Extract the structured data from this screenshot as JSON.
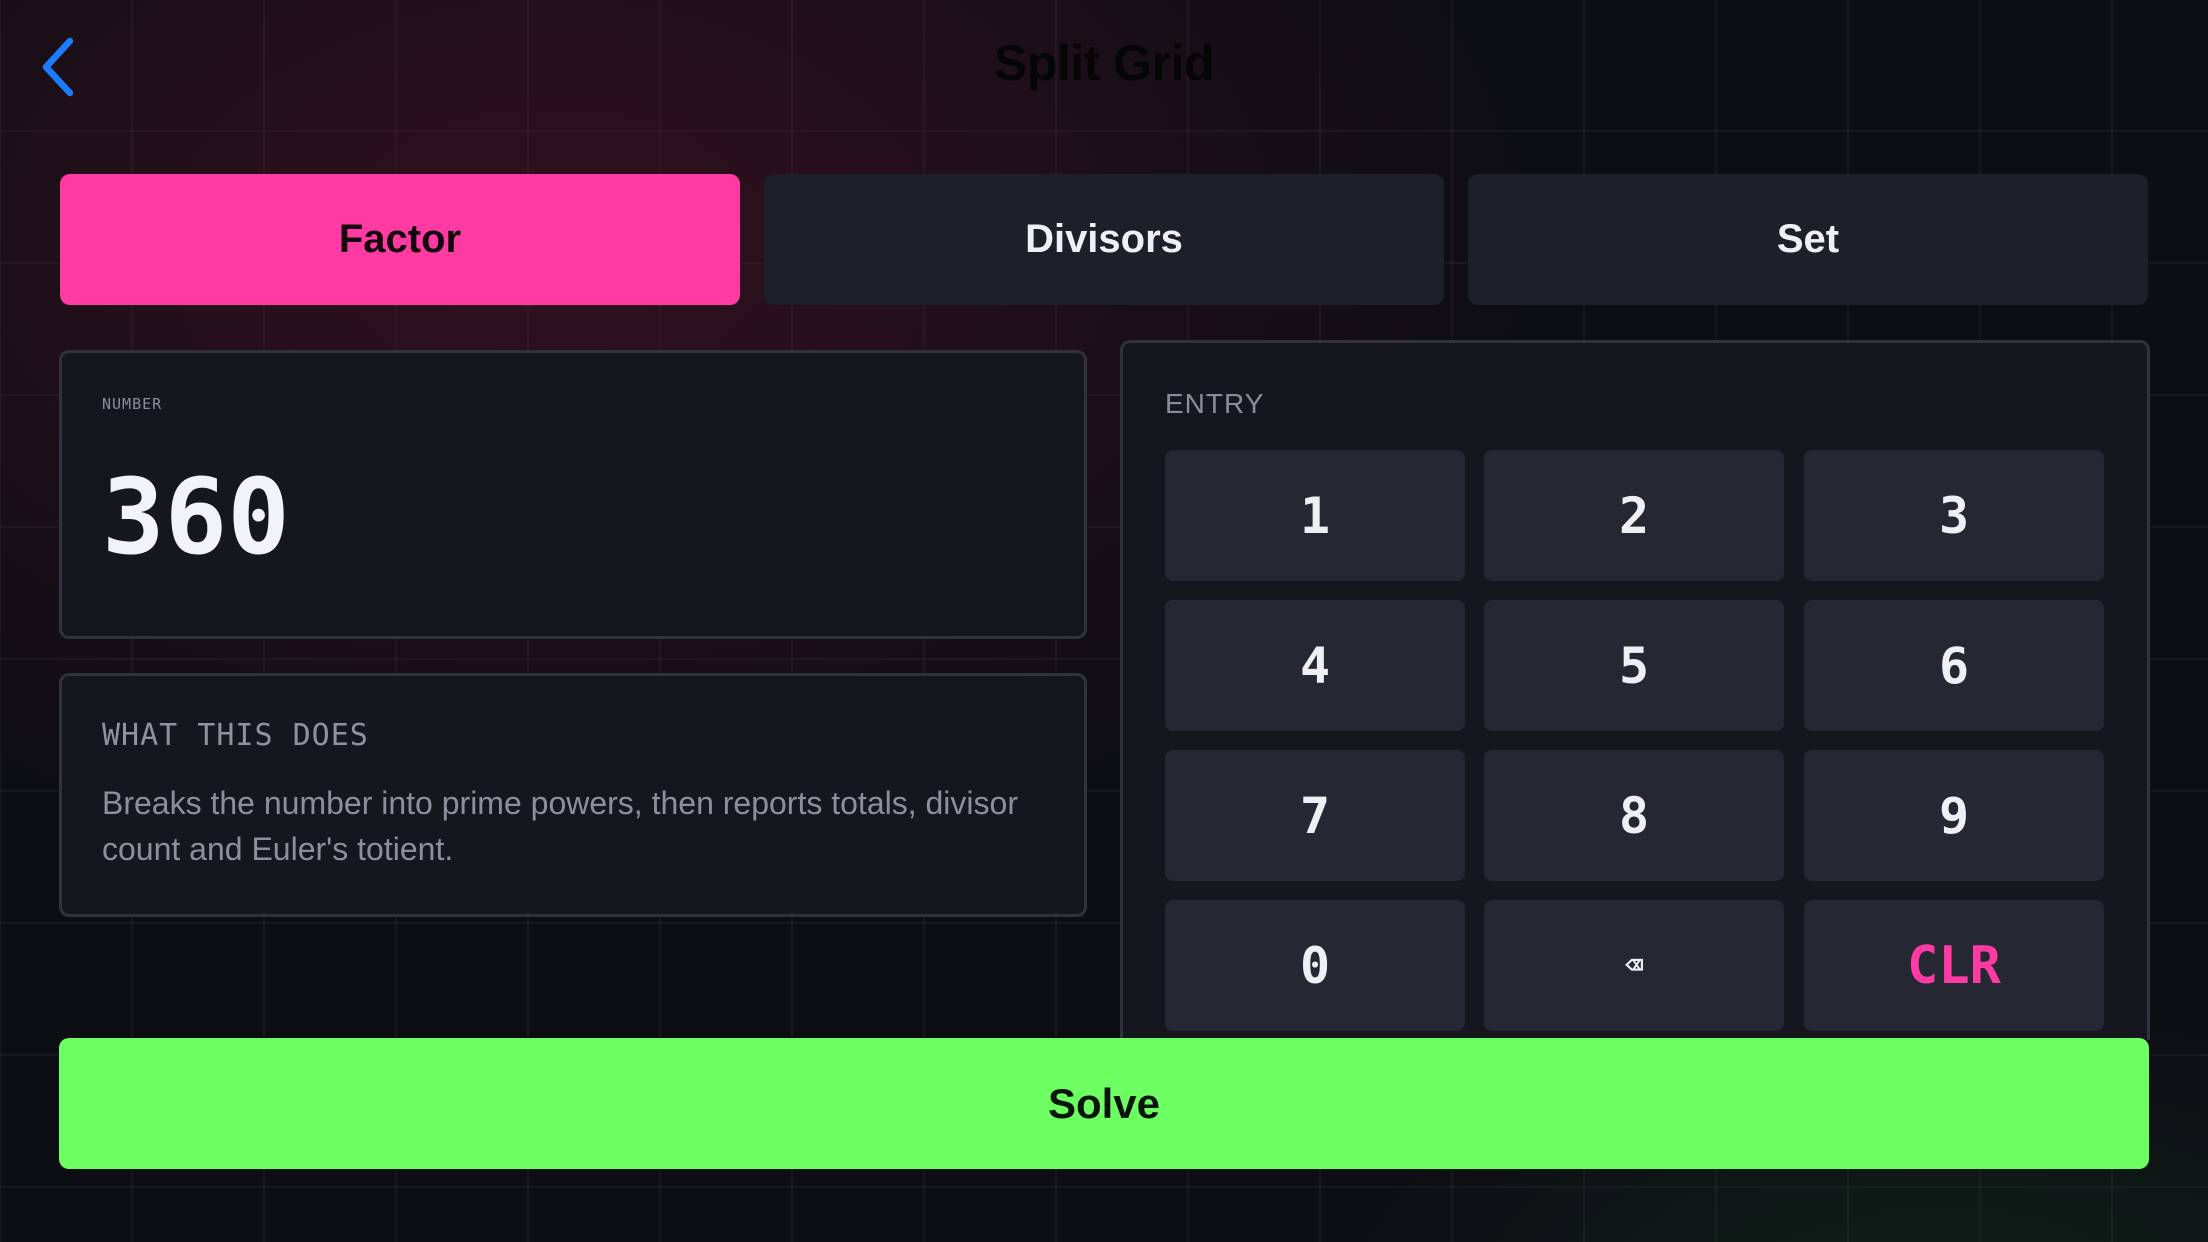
{
  "header": {
    "title": "Split Grid",
    "back_icon": "chevron-left-icon",
    "accent_color": "#1a7cff"
  },
  "tabs": [
    {
      "label": "Factor",
      "active": true
    },
    {
      "label": "Divisors",
      "active": false
    },
    {
      "label": "Set",
      "active": false
    }
  ],
  "number": {
    "label": "NUMBER",
    "value": "360"
  },
  "info": {
    "heading": "WHAT THIS DOES",
    "body": "Breaks the number into prime powers, then reports totals, divisor count and Euler's totient."
  },
  "keypad": {
    "label": "ENTRY",
    "keys": [
      "1",
      "2",
      "3",
      "4",
      "5",
      "6",
      "7",
      "8",
      "9",
      "0",
      "⌫",
      "CLR"
    ]
  },
  "solve": {
    "label": "Solve"
  },
  "colors": {
    "active_tab": "#ff3ba3",
    "solve": "#6dff62",
    "clear_key": "#ff3ba3"
  }
}
